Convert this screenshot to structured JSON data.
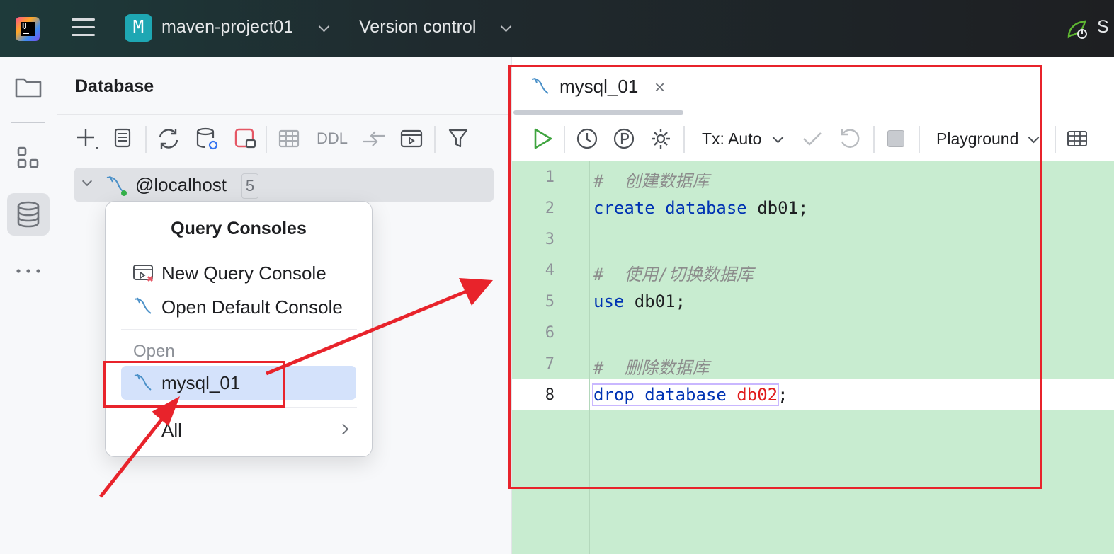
{
  "header": {
    "logo_letters": "IJ",
    "project_badge": "M",
    "project_name": "maven-project01",
    "vcs_label": "Version control",
    "right_cut": "S"
  },
  "database_panel": {
    "title": "Database",
    "toolbar_ddl": "DDL",
    "tree": {
      "host_label": "@localhost",
      "host_count": "5"
    }
  },
  "popup": {
    "title": "Query Consoles",
    "new_console": "New Query Console",
    "open_default": "Open Default Console",
    "open_section": "Open",
    "selected_item": "mysql_01",
    "all_item": "All"
  },
  "editor": {
    "tab_label": "mysql_01",
    "tab_close": "×",
    "tx_label": "Tx: Auto",
    "playground_label": "Playground",
    "lines": [
      {
        "no": "1",
        "text": "#  创建数据库"
      },
      {
        "no": "2",
        "kw1": "create",
        "kw2": "database",
        "rest": " db01;"
      },
      {
        "no": "3"
      },
      {
        "no": "4",
        "text": "#  使用/切换数据库"
      },
      {
        "no": "5",
        "kw1": "use",
        "rest": " db01;"
      },
      {
        "no": "6"
      },
      {
        "no": "7",
        "text": "#  删除数据库"
      },
      {
        "no": "8",
        "kw1": "drop",
        "kw2": "database",
        "err": "db02",
        "rest": ";"
      }
    ]
  },
  "colors": {
    "code_bg": "#c8ecd0",
    "keyword": "#0033b3",
    "annotation_red": "#e8232b",
    "selection_blue": "#d4e2fb"
  }
}
